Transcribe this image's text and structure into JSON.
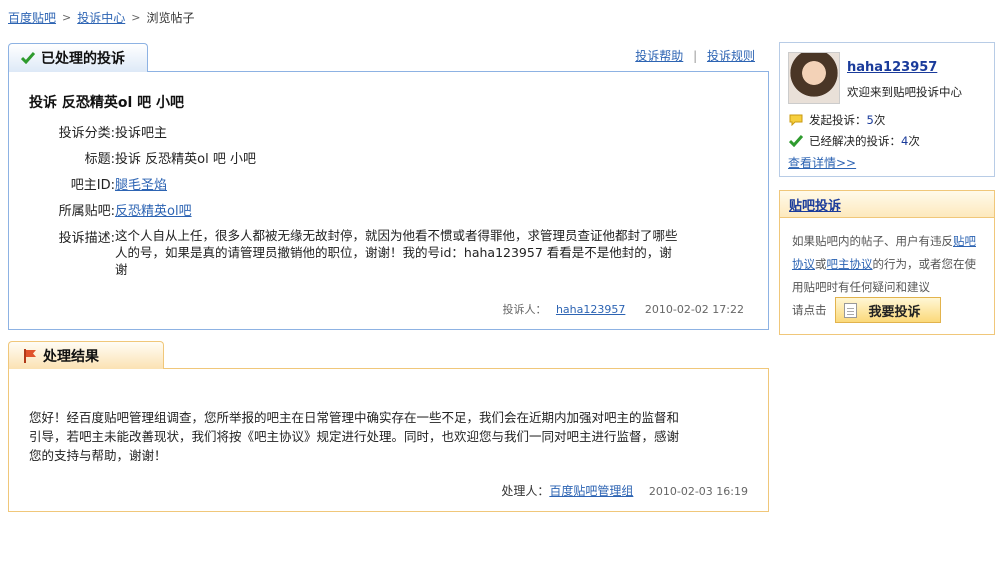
{
  "breadcrumb": {
    "items": [
      "百度贴吧",
      "投诉中心",
      "浏览帖子"
    ],
    "separator": ">"
  },
  "complaint": {
    "tab_title": "已处理的投诉",
    "links": [
      "投诉帮助",
      "投诉规则"
    ],
    "heading": "投诉 反恐精英ol 吧 小吧",
    "fields": {
      "category_label": "投诉分类:",
      "category_value": "投诉吧主",
      "title_label": "标题:",
      "title_value": "投诉 反恐精英ol 吧 小吧",
      "owner_label": "吧主ID:",
      "owner_value": "腿毛圣焰",
      "forum_label": "所属贴吧:",
      "forum_value": "反恐精英ol吧",
      "desc_label": "投诉描述:",
      "desc_value": "这个人自从上任，很多人都被无缘无故封停，就因为他看不惯或者得罪他，求管理员查证他都封了哪些人的号，如果是真的请管理员撤销他的职位，谢谢！我的号id：haha123957 看看是不是他封的，谢谢"
    },
    "complainant_label": "投诉人：",
    "complainant": "haha123957",
    "time": "2010-02-02 17:22"
  },
  "result": {
    "tab_title": "处理结果",
    "text": "您好！经百度贴吧管理组调查，您所举报的吧主在日常管理中确实存在一些不足，我们会在近期内加强对吧主的监督和引导，若吧主未能改善现状，我们将按《吧主协议》规定进行处理。同时，也欢迎您与我们一同对吧主进行监督，感谢您的支持与帮助，谢谢！",
    "handler_label": "处理人：",
    "handler": "百度贴吧管理组",
    "time": "2010-02-03 16:19"
  },
  "user": {
    "name": "haha123957",
    "welcome": "欢迎来到贴吧投诉中心",
    "stat1_label": "发起投诉：",
    "stat1_value": "5",
    "stat1_unit": "次",
    "stat2_label": "已经解决的投诉：",
    "stat2_value": "4",
    "stat2_unit": "次",
    "detail_link": "查看详情>>"
  },
  "tieba_complaint": {
    "header": "贴吧投诉",
    "text_1": "如果贴吧内的帖子、用户有违反",
    "link_1": "贴吧协议",
    "text_2": "或",
    "link_2": "吧主协议",
    "text_3": "的行为，或者您在使用贴吧时有任何疑问和建议",
    "prompt": "请点击",
    "button": "我要投诉"
  },
  "colors": {
    "link": "#2d64b3",
    "blue_border": "#8db2e3",
    "orange_border": "#f0c77a"
  }
}
